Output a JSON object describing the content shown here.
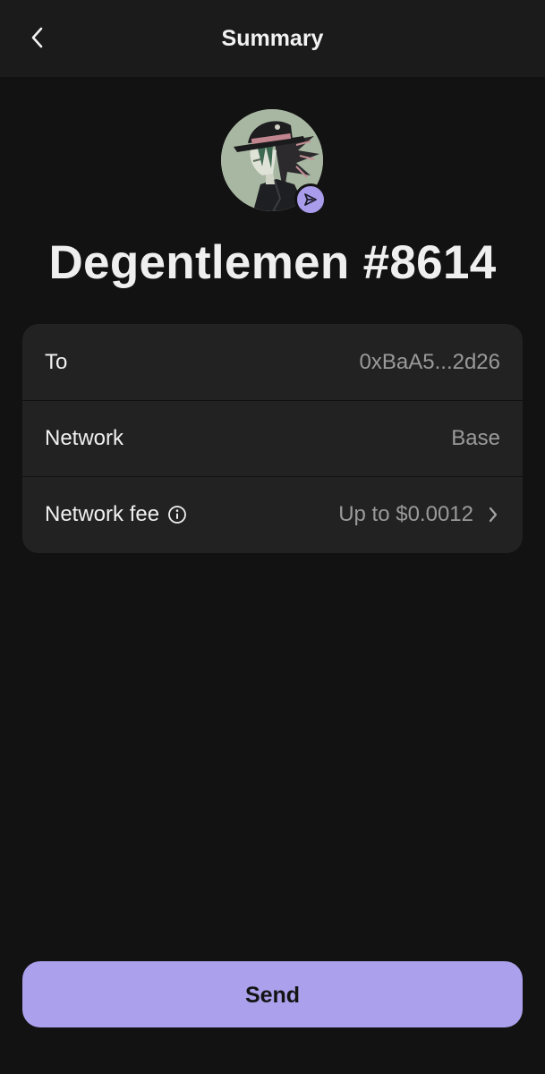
{
  "header": {
    "title": "Summary",
    "back_icon": "chevron-left-icon"
  },
  "nft": {
    "name": "Degentlemen #8614",
    "avatar": "anime-character-avatar",
    "badge_icon": "send-arrow-icon"
  },
  "details": {
    "rows": [
      {
        "label": "To",
        "value": "0xBaA5...2d26"
      },
      {
        "label": "Network",
        "value": "Base"
      },
      {
        "label": "Network fee",
        "value": "Up to $0.0012",
        "info_icon": "info-icon",
        "trailing_icon": "chevron-right-icon"
      }
    ]
  },
  "actions": {
    "send_label": "Send"
  },
  "colors": {
    "background": "#121212",
    "header_bg": "#1b1b1b",
    "card_bg": "#222222",
    "accent": "#aba0ec",
    "muted_text": "#9a9a9a"
  }
}
